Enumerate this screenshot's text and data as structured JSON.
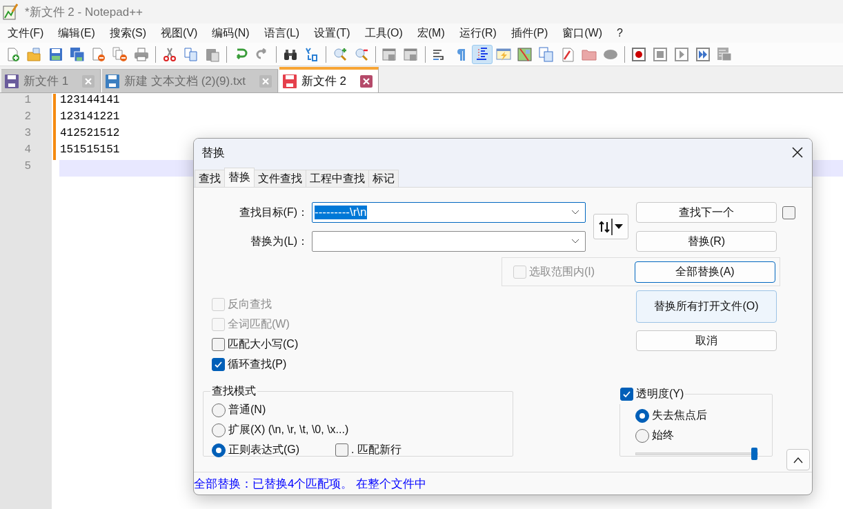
{
  "window": {
    "title": "*新文件 2 - Notepad++"
  },
  "menu": [
    "文件(F)",
    "编辑(E)",
    "搜索(S)",
    "视图(V)",
    "编码(N)",
    "语言(L)",
    "设置(T)",
    "工具(O)",
    "宏(M)",
    "运行(R)",
    "插件(P)",
    "窗口(W)",
    "?"
  ],
  "toolbar": [
    [
      {
        "kind": "new",
        "pressed": false
      },
      {
        "kind": "open",
        "pressed": false
      },
      {
        "kind": "save",
        "pressed": false
      },
      {
        "kind": "save_all",
        "pressed": false
      },
      {
        "kind": "close",
        "pressed": false
      },
      {
        "kind": "close_all",
        "pressed": false
      },
      {
        "kind": "print",
        "pressed": false
      }
    ],
    [
      {
        "kind": "cut",
        "pressed": false
      },
      {
        "kind": "copy",
        "pressed": false
      },
      {
        "kind": "paste",
        "pressed": false
      }
    ],
    [
      {
        "kind": "undo",
        "pressed": false
      },
      {
        "kind": "redo",
        "pressed": false
      }
    ],
    [
      {
        "kind": "find",
        "pressed": false
      },
      {
        "kind": "replace",
        "pressed": false
      }
    ],
    [
      {
        "kind": "zoom_in",
        "pressed": false
      },
      {
        "kind": "zoom_out",
        "pressed": false
      }
    ],
    [
      {
        "kind": "sync_v",
        "pressed": false
      },
      {
        "kind": "sync_h",
        "pressed": false
      }
    ],
    [
      {
        "kind": "wrap",
        "pressed": false
      },
      {
        "kind": "all_chars",
        "pressed": false
      },
      {
        "kind": "indent_guide",
        "pressed": true
      },
      {
        "kind": "udl",
        "pressed": false
      },
      {
        "kind": "doc_map",
        "pressed": false
      },
      {
        "kind": "doc_list",
        "pressed": false
      },
      {
        "kind": "function_list",
        "pressed": false
      },
      {
        "kind": "folder",
        "pressed": false
      },
      {
        "kind": "monitor",
        "pressed": false
      }
    ],
    [
      {
        "kind": "record",
        "pressed": false
      },
      {
        "kind": "stop",
        "pressed": false
      },
      {
        "kind": "play",
        "pressed": false
      },
      {
        "kind": "play_multi",
        "pressed": false
      },
      {
        "kind": "save_macro",
        "pressed": false
      }
    ]
  ],
  "tabs": [
    {
      "label": "新文件 1",
      "selected": false,
      "color": "#6a5c9c"
    },
    {
      "label": "新建 文本文档 (2)(9).txt",
      "selected": false,
      "color": "#3d7fc0"
    },
    {
      "label": "新文件 2",
      "selected": true,
      "color": "#e5404c"
    }
  ],
  "editor": {
    "lines": [
      {
        "number": "1",
        "text": "123144141",
        "modified": true,
        "current": false
      },
      {
        "number": "2",
        "text": "123141221",
        "modified": true,
        "current": false
      },
      {
        "number": "3",
        "text": "412521512",
        "modified": true,
        "current": false
      },
      {
        "number": "4",
        "text": "151515151",
        "modified": true,
        "current": false
      },
      {
        "number": "5",
        "modified": false,
        "current": true
      }
    ]
  },
  "dialog": {
    "title": "替换",
    "tabs": [
      {
        "label": "查找",
        "selected": false
      },
      {
        "label": "替换",
        "selected": true
      },
      {
        "label": "文件查找",
        "selected": false
      },
      {
        "label": "工程中查找",
        "selected": false
      },
      {
        "label": "标记",
        "selected": false
      }
    ],
    "find": {
      "label": "查找目标(F)：",
      "value": "---------\\r\\n",
      "highlighted": true
    },
    "replace": {
      "label": "替换为(L)："
    },
    "side_check": {
      "checked": false
    },
    "scope": {
      "label": "选取范围内(I)",
      "checked": false,
      "disabled": true
    },
    "buttons": [
      {
        "label": "查找下一个",
        "default": false,
        "hovered": false
      },
      {
        "label": "替换(R)",
        "default": false,
        "hovered": false
      },
      {
        "label": "全部替换(A)",
        "default": true,
        "hovered": false
      },
      {
        "label": "替换所有打开文件(O)",
        "default": false,
        "hovered": true
      },
      {
        "label": "取消",
        "default": false,
        "hovered": false
      }
    ],
    "options": [
      {
        "label": "反向查找",
        "checked": false,
        "disabled": true
      },
      {
        "label": "全词匹配(W)",
        "checked": false,
        "disabled": true
      },
      {
        "label": "匹配大小写(C)",
        "checked": false,
        "disabled": false
      },
      {
        "label": "循环查找(P)",
        "checked": true,
        "disabled": false
      }
    ],
    "search_mode": {
      "title": "查找模式",
      "options": [
        {
          "label": "普通(N)",
          "selected": false
        },
        {
          "label": "扩展(X) (\\n, \\r, \\t, \\0, \\x...)",
          "selected": false
        },
        {
          "label": "正则表达式(G)",
          "selected": true
        }
      ],
      "dot_newline": {
        "label": ". 匹配新行",
        "checked": false
      }
    },
    "transparency": {
      "label": "透明度(Y)",
      "checked": true,
      "options": [
        {
          "label": "失去焦点后",
          "selected": true
        },
        {
          "label": "始终",
          "selected": false
        }
      ],
      "level": 1
    },
    "status": "全部替换：已替换4个匹配项。 在整个文件中"
  }
}
